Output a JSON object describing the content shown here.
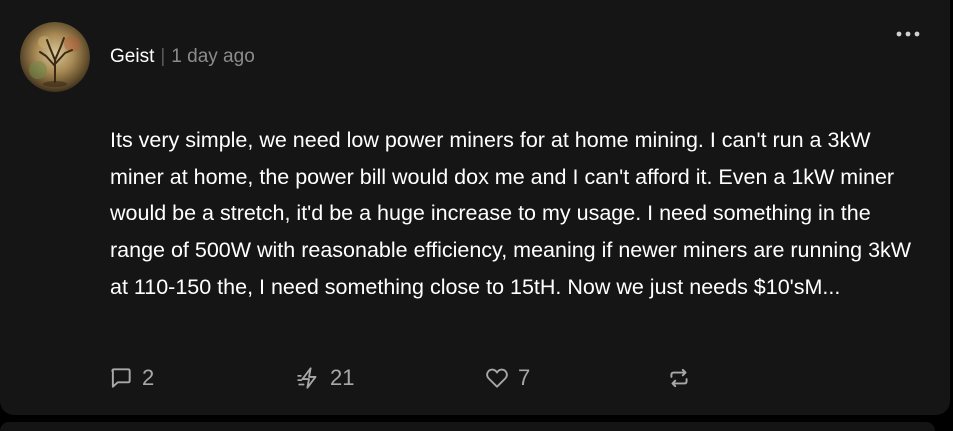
{
  "post": {
    "author": {
      "name": "Geist",
      "separator": "|",
      "timestamp": "1 day ago",
      "avatar": "tree-avatar"
    },
    "text": "Its very simple, we need low power miners for at home mining. I can't run a 3kW miner at home, the power bill would dox me and I can't afford it. Even a 1kW miner would be a stretch, it'd be a huge increase to my usage. I need something in the range of 500W with reasonable efficiency, meaning if newer miners are running 3kW at 110-150 the, I need something close to 15tH. Now we just needs $10'sM...",
    "actions": {
      "replies": {
        "icon": "reply-icon",
        "count": "2"
      },
      "zaps": {
        "icon": "zap-icon",
        "count": "21"
      },
      "likes": {
        "icon": "heart-icon",
        "count": "7"
      },
      "reposts": {
        "icon": "repost-icon",
        "count": ""
      }
    },
    "menu": {
      "icon": "more-icon"
    }
  },
  "colors": {
    "background": "#000000",
    "card": "#151515",
    "text": "#ffffff",
    "muted": "#8c8c8c",
    "icon": "#a8a8a8"
  }
}
